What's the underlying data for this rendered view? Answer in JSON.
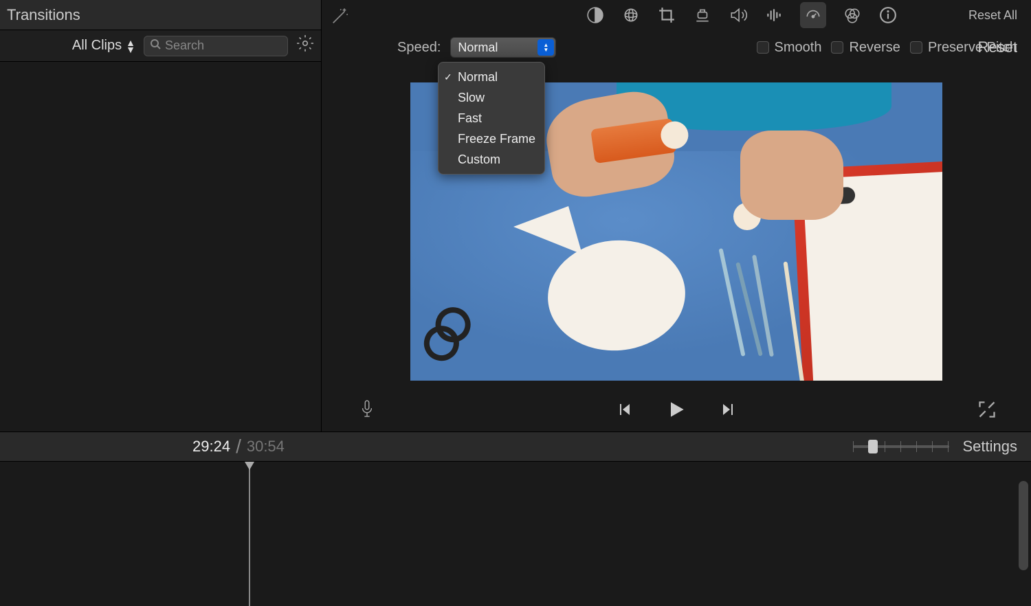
{
  "sidebar": {
    "title": "Transitions",
    "clips_dropdown": "All Clips",
    "search_placeholder": "Search"
  },
  "adjustments": {
    "reset_all": "Reset All"
  },
  "speed": {
    "label": "Speed:",
    "value": "Normal",
    "options": {
      "normal": "Normal",
      "slow": "Slow",
      "fast": "Fast",
      "freeze": "Freeze Frame",
      "custom": "Custom"
    },
    "smooth": "Smooth",
    "reverse": "Reverse",
    "preserve_pitch": "Preserve Pitch",
    "reset": "Reset"
  },
  "timeline": {
    "current": "29:24",
    "separator": "/",
    "total": "30:54",
    "settings": "Settings"
  }
}
